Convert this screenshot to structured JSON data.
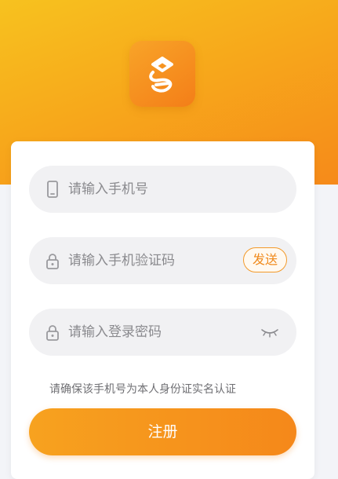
{
  "colors": {
    "accent": "#f5881a",
    "hero_top": "#f7c21f",
    "field_bg": "#f1f1f3",
    "placeholder": "#8a8a8e"
  },
  "logo": {
    "icon": "app-logo-icon"
  },
  "form": {
    "phone": {
      "placeholder": "请输入手机号",
      "value": "",
      "icon": "phone-icon"
    },
    "code": {
      "placeholder": "请输入手机验证码",
      "value": "",
      "icon": "lock-icon",
      "send_label": "发送"
    },
    "password": {
      "placeholder": "请输入登录密码",
      "value": "",
      "icon": "lock-icon",
      "toggle_icon": "eye-closed-icon"
    },
    "notice": "请确保该手机号为本人身份证实名认证",
    "submit_label": "注册"
  }
}
